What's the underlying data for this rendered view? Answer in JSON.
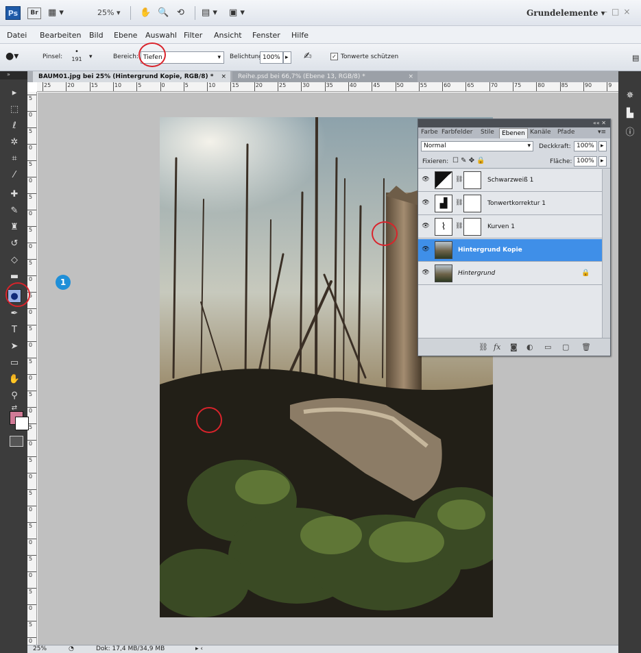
{
  "appbar": {
    "logo": "Ps",
    "bridge": "Br",
    "zoom": "25%",
    "workspace": "Grundelemente"
  },
  "menu": [
    "Datei",
    "Bearbeiten",
    "Bild",
    "Ebene",
    "Auswahl",
    "Filter",
    "Ansicht",
    "Fenster",
    "Hilfe"
  ],
  "options": {
    "brush_label": "Pinsel:",
    "brush_size": "191",
    "range_label": "Bereich:",
    "range_value": "Tiefen",
    "exposure_label": "Belichtung:",
    "exposure_value": "100%",
    "protect_label": "Tonwerte schützen"
  },
  "tabs": [
    {
      "label": "BAUM01.jpg bei 25% (Hintergrund Kopie, RGB/8) *",
      "close": "×"
    },
    {
      "label": "Reihe.psd bei 66,7% (Ebene 13, RGB/8) *",
      "close": "×"
    }
  ],
  "ruler_top": [
    "25",
    "20",
    "15",
    "10",
    "5",
    "0",
    "5",
    "10",
    "15",
    "20",
    "25",
    "30",
    "35",
    "40",
    "45",
    "50",
    "55",
    "60",
    "65",
    "70",
    "75",
    "80",
    "85",
    "90",
    "9"
  ],
  "ruler_left": [
    "5",
    "0",
    "5",
    "0",
    "5",
    "0",
    "5",
    "0",
    "5",
    "0",
    "5",
    "0",
    "5",
    "0",
    "5",
    "0",
    "5",
    "0",
    "5",
    "0",
    "5",
    "0",
    "5",
    "0",
    "5",
    "0",
    "5",
    "0",
    "5",
    "0",
    "5",
    "0",
    "5",
    "0"
  ],
  "colors": {
    "foreground": "#d17a96",
    "background": "#ffffff",
    "selection": "#3f8fe8",
    "annotation": "#d9232b",
    "badge": "#1f8fd8"
  },
  "layers_panel": {
    "tabs": [
      "Farbe",
      "Farbfelder",
      "Stile",
      "Ebenen",
      "Kanäle",
      "Pfade"
    ],
    "active_tab": "Ebenen",
    "blend_mode": "Normal",
    "opacity_label": "Deckkraft:",
    "opacity_value": "100%",
    "lock_label": "Fixieren:",
    "fill_label": "Fläche:",
    "fill_value": "100%",
    "layers": [
      {
        "name": "Schwarzweiß 1",
        "type": "adjustment-bw",
        "active": false,
        "locked": false
      },
      {
        "name": "Tonwertkorrektur 1",
        "type": "adjustment-levels",
        "active": false,
        "locked": false
      },
      {
        "name": "Kurven 1",
        "type": "adjustment-curves",
        "active": false,
        "locked": false
      },
      {
        "name": "Hintergrund Kopie",
        "type": "pixel",
        "active": true,
        "locked": false
      },
      {
        "name": "Hintergrund",
        "type": "pixel",
        "active": false,
        "locked": true
      }
    ]
  },
  "status": {
    "zoom": "25%",
    "doc": "Dok: 17,4 MB/34,9 MB"
  },
  "badge": "1"
}
